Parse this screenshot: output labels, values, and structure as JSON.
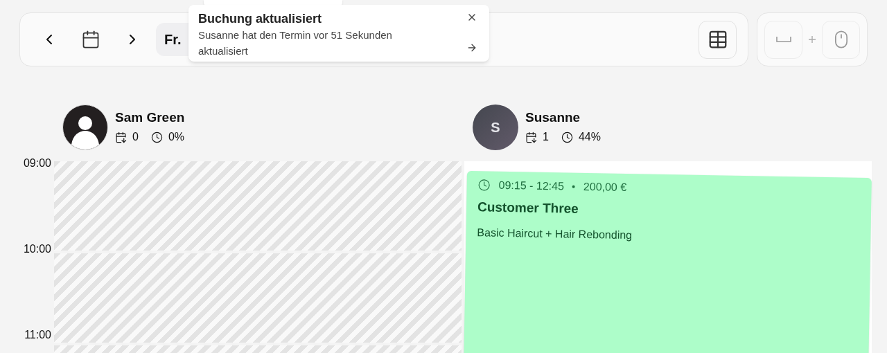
{
  "toolbar": {
    "date_label": "Fr."
  },
  "toast": {
    "title": "Buchung aktualisiert",
    "message": "Susanne hat den Termin vor 51 Sekunden aktualisiert"
  },
  "staff": [
    {
      "name": "Sam Green",
      "avatar": {
        "kind": "silhouette"
      },
      "bookings": "0",
      "utilization": "0%"
    },
    {
      "name": "Susanne",
      "avatar": {
        "kind": "initial",
        "initial": "S"
      },
      "bookings": "1",
      "utilization": "44%"
    }
  ],
  "times": [
    "09:00",
    "10:00",
    "11:00"
  ],
  "appointment": {
    "time": "09:15 - 12:45",
    "price": "200,00 €",
    "customer": "Customer Three",
    "services": "Basic Haircut + Hair Rebonding",
    "color": "#adfdc9"
  }
}
